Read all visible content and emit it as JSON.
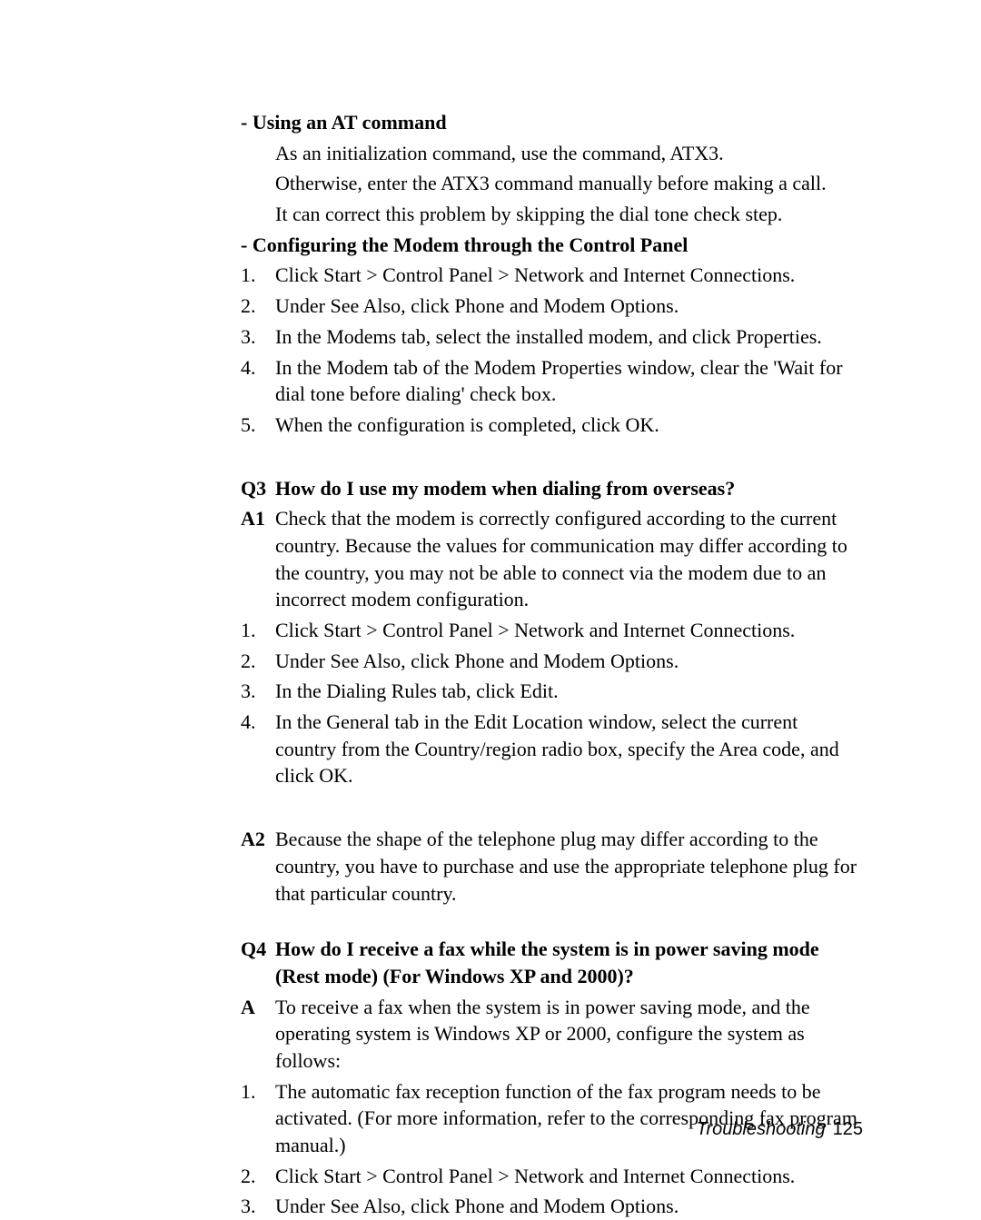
{
  "sec1": {
    "heading": "- Using an AT command",
    "p1": "As an initialization command, use the command, ATX3.",
    "p2": "Otherwise, enter the ATX3 command manually before making a call.",
    "p3": "It can correct this problem by skipping the dial tone check step."
  },
  "sec2": {
    "heading": "- Configuring the Modem through the Control Panel",
    "items": [
      {
        "n": "1.",
        "t": "Click Start > Control Panel > Network and Internet Connections."
      },
      {
        "n": "2.",
        "t": "Under See Also, click Phone and Modem Options."
      },
      {
        "n": "3.",
        "t": "In the Modems tab, select the installed modem, and click Properties."
      },
      {
        "n": "4.",
        "t": "In the Modem tab of the Modem Properties window, clear the 'Wait for dial tone before dialing' check box."
      },
      {
        "n": "5.",
        "t": "When the configuration is completed, click OK."
      }
    ]
  },
  "q3": {
    "lbl": "Q3",
    "q": "How do I use my modem when dialing from overseas?",
    "a1_lbl": "A1",
    "a1": "Check that the modem is correctly configured according to the current country. Because the values for communication may differ according to the country, you may not be able to connect via the modem due to an incorrect modem configuration.",
    "items": [
      {
        "n": "1.",
        "t": "Click Start > Control Panel > Network and Internet Connections."
      },
      {
        "n": "2.",
        "t": "Under See Also, click Phone and Modem Options."
      },
      {
        "n": "3.",
        "t": "In the Dialing Rules tab, click Edit."
      },
      {
        "n": "4.",
        "t": "In the General tab in the Edit Location window, select the current country from the Country/region radio box, specify the Area code, and click OK."
      }
    ],
    "a2_lbl": "A2",
    "a2": "Because the shape of the telephone plug may differ according to the country, you have to purchase and use the appropriate telephone plug for that particular country."
  },
  "q4": {
    "lbl": "Q4",
    "q": "How do I receive a fax while the system is in power saving mode (Rest mode) (For Windows XP and 2000)?",
    "a_lbl": "A",
    "a": "To receive a fax when the system is in power saving mode, and the operating system is Windows XP or 2000, configure the system as follows:",
    "items": [
      {
        "n": "1.",
        "t": "The automatic fax reception function of the fax program needs to be activated. (For more information, refer to the corresponding fax program manual.)"
      },
      {
        "n": "2.",
        "t": "Click Start > Control Panel > Network and Internet Connections."
      },
      {
        "n": "3.",
        "t": "Under See Also, click Phone and Modem Options."
      }
    ]
  },
  "footer": {
    "section": "Troubleshooting",
    "page": "125"
  }
}
